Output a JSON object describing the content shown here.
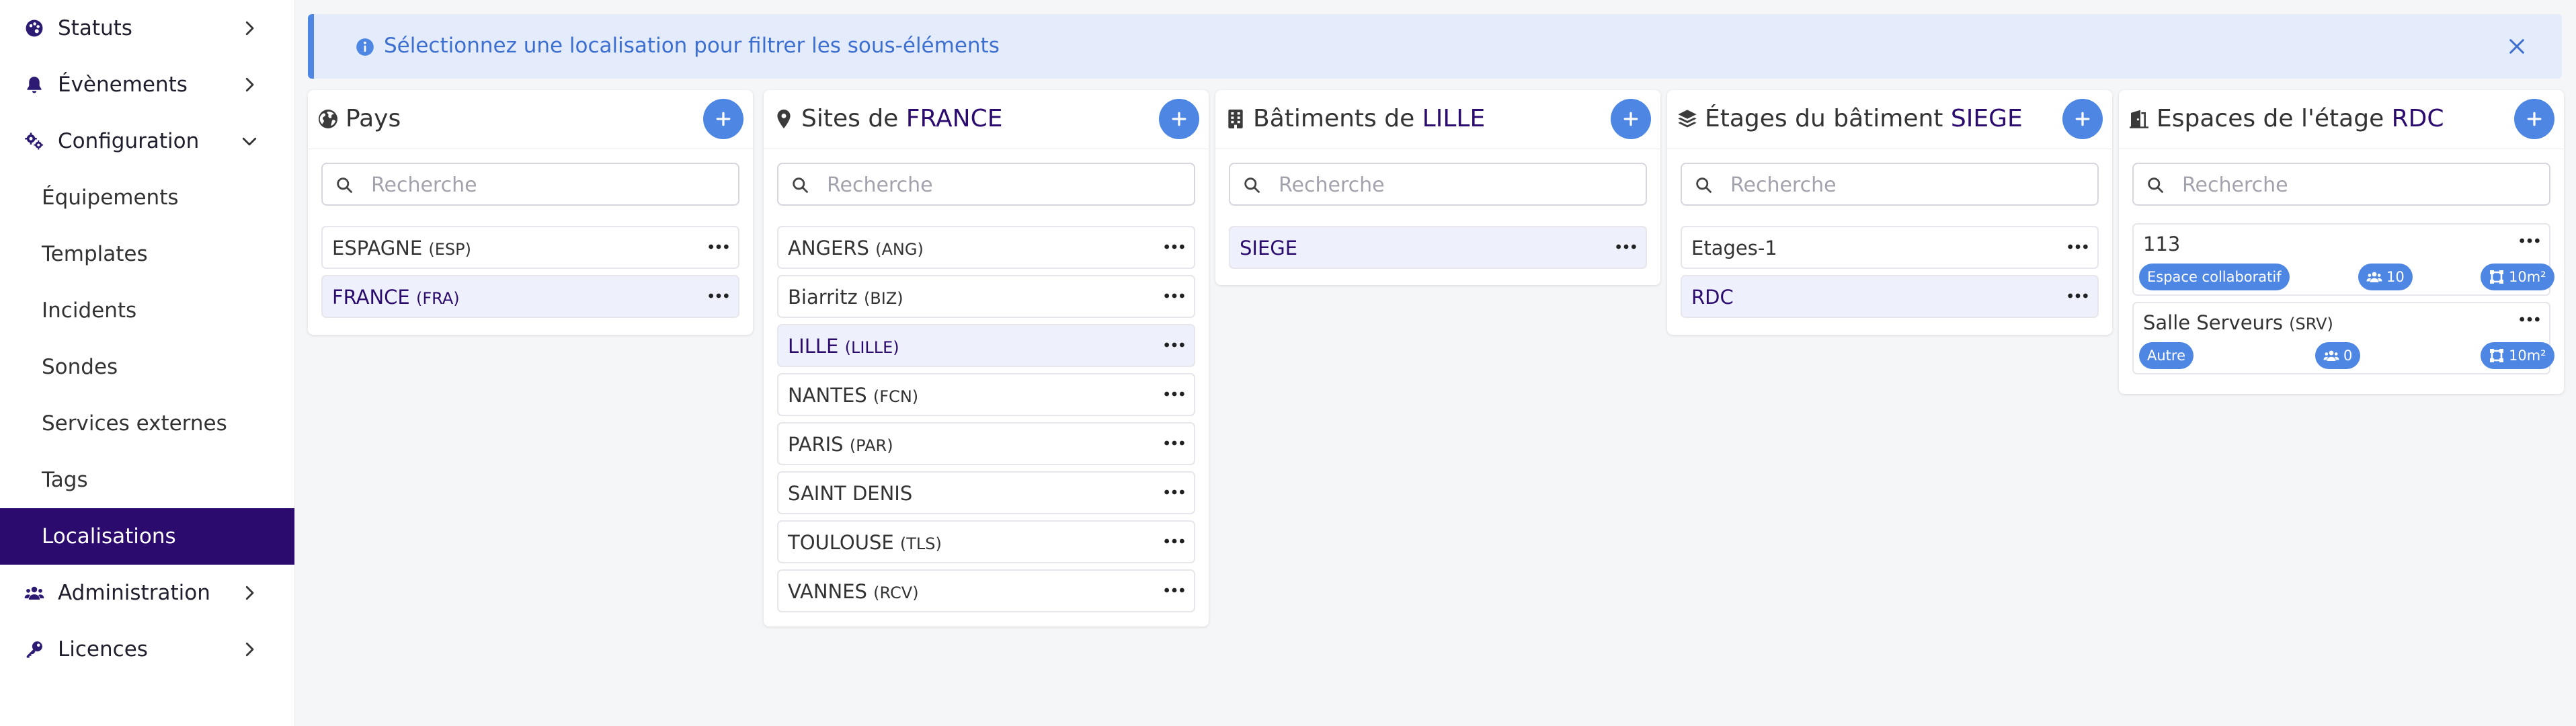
{
  "sidebar": {
    "items": [
      {
        "label": "Statuts",
        "icon": "palette-icon",
        "type": "top",
        "chevron": "right"
      },
      {
        "label": "Évènements",
        "icon": "bell-icon",
        "type": "top",
        "chevron": "right"
      },
      {
        "label": "Configuration",
        "icon": "gears-icon",
        "type": "top",
        "chevron": "down"
      },
      {
        "label": "Équipements",
        "type": "sub"
      },
      {
        "label": "Templates",
        "type": "sub"
      },
      {
        "label": "Incidents",
        "type": "sub"
      },
      {
        "label": "Sondes",
        "type": "sub"
      },
      {
        "label": "Services externes",
        "type": "sub"
      },
      {
        "label": "Tags",
        "type": "sub"
      },
      {
        "label": "Localisations",
        "type": "sub",
        "active": true
      },
      {
        "label": "Administration",
        "icon": "users-icon",
        "type": "top",
        "chevron": "right"
      },
      {
        "label": "Licences",
        "icon": "key-icon",
        "type": "top",
        "chevron": "right"
      }
    ]
  },
  "alert": {
    "text": "Sélectionnez une localisation pour filtrer les sous-éléments"
  },
  "search_placeholder": "Recherche",
  "colors": {
    "accent": "#4e86e4",
    "brand": "#2c0b6e",
    "alert_bg": "#e4ebfa"
  },
  "panels": [
    {
      "id": "pays",
      "icon": "globe-icon",
      "title_prefix": "Pays",
      "title_highlight": "",
      "rows": [
        {
          "name": "ESPAGNE",
          "code": "(ESP)",
          "selected": false
        },
        {
          "name": "FRANCE",
          "code": "(FRA)",
          "selected": true
        }
      ]
    },
    {
      "id": "sites",
      "icon": "map-pin-icon",
      "title_prefix": "Sites de ",
      "title_highlight": "FRANCE",
      "rows": [
        {
          "name": "ANGERS",
          "code": "(ANG)",
          "selected": false
        },
        {
          "name": "Biarritz",
          "code": "(BIZ)",
          "selected": false
        },
        {
          "name": "LILLE",
          "code": "(LILLE)",
          "selected": true
        },
        {
          "name": "NANTES",
          "code": "(FCN)",
          "selected": false
        },
        {
          "name": "PARIS",
          "code": "(PAR)",
          "selected": false
        },
        {
          "name": "SAINT DENIS",
          "code": "",
          "selected": false
        },
        {
          "name": "TOULOUSE",
          "code": "(TLS)",
          "selected": false
        },
        {
          "name": "VANNES",
          "code": "(RCV)",
          "selected": false
        }
      ]
    },
    {
      "id": "batiments",
      "icon": "building-icon",
      "title_prefix": "Bâtiments de ",
      "title_highlight": "LILLE",
      "rows": [
        {
          "name": "SIEGE",
          "code": "",
          "selected": true
        }
      ]
    },
    {
      "id": "etages",
      "icon": "layers-icon",
      "title_prefix": "Étages du bâtiment ",
      "title_highlight": "SIEGE",
      "rows": [
        {
          "name": "Etages-1",
          "code": "",
          "selected": false
        },
        {
          "name": "RDC",
          "code": "",
          "selected": true
        }
      ]
    },
    {
      "id": "espaces",
      "icon": "door-icon",
      "title_prefix": "Espaces de l'étage ",
      "title_highlight": "RDC",
      "cards": [
        {
          "name": "113",
          "code": "",
          "type": "Espace collaboratif",
          "capacity": "10",
          "area": "10m²"
        },
        {
          "name": "Salle Serveurs",
          "code": "(SRV)",
          "type": "Autre",
          "capacity": "0",
          "area": "10m²"
        }
      ]
    }
  ]
}
